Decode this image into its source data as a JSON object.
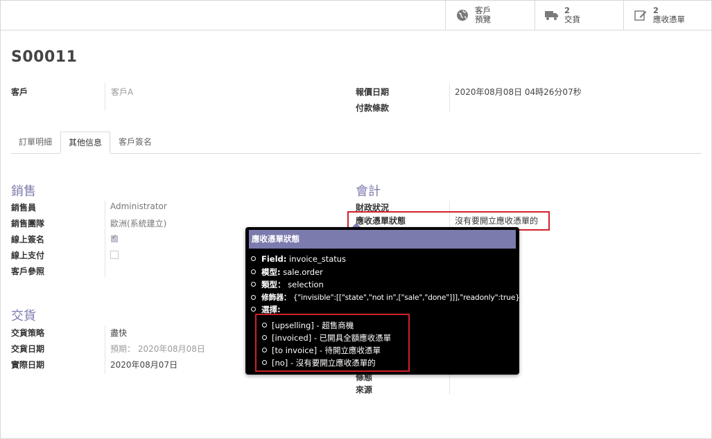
{
  "smart_buttons": [
    {
      "count": "",
      "line1": "客戶",
      "line2": "預覽",
      "icon": "globe-icon"
    },
    {
      "count": "2",
      "line1": "交貨",
      "line2": "",
      "icon": "truck-icon"
    },
    {
      "count": "2",
      "line1": "應收憑單",
      "line2": "",
      "icon": "edit-icon"
    }
  ],
  "record": {
    "title": "S00011"
  },
  "header_fields": {
    "customer_label": "客戶",
    "customer_value": "客戶A",
    "quote_date_label": "報價日期",
    "quote_date_value": "2020年08月08日 04時26分07秒",
    "payment_terms_label": "付款條款"
  },
  "tabs": [
    "訂單明細",
    "其他信息",
    "客戶簽名"
  ],
  "sales": {
    "heading": "銷售",
    "salesperson_label": "銷售員",
    "salesperson_value": "Administrator",
    "team_label": "銷售團隊",
    "team_value": "歐洲(系統建立)",
    "online_sign_label": "線上簽名",
    "online_sign_checked": true,
    "online_pay_label": "線上支付",
    "online_pay_checked": false,
    "customer_ref_label": "客戶參照"
  },
  "delivery": {
    "heading": "交貨",
    "policy_label": "交貨策略",
    "policy_value": "盡快",
    "date_label": "交貨日期",
    "date_value": "預期： 2020年08月08日",
    "actual_label": "實際日期",
    "actual_value": "2020年08月07日"
  },
  "accounting": {
    "heading": "會計",
    "fiscal_label": "財政狀況",
    "invoice_status_label": "應收憑單狀態",
    "invoice_status_value": "沒有要開立應收憑單的"
  },
  "other_partial": {
    "label_a": "條態",
    "label_b": "來源"
  },
  "tooltip": {
    "title": "應收憑單狀態",
    "field_key": "Field:",
    "field_val": "invoice_status",
    "model_key": "模型:",
    "model_val": "sale.order",
    "type_key": "類型：",
    "type_val": "selection",
    "modifiers_key": "修飾器：",
    "modifiers_val": "{\"invisible\":[[\"state\",\"not in\",[\"sale\",\"done\"]]],\"readonly\":true}",
    "selection_key": "選擇:",
    "options": [
      {
        "key": "[upselling]",
        "label": "- 超售商機"
      },
      {
        "key": "[invoiced]",
        "label": "- 已開具全額應收憑單"
      },
      {
        "key": "[to invoice]",
        "label": "- 待開立應收憑單"
      },
      {
        "key": "[no]",
        "label": "- 沒有要開立應收憑單的"
      }
    ]
  },
  "colors": {
    "accent": "#7c7bad",
    "highlight": "#d2202a"
  }
}
